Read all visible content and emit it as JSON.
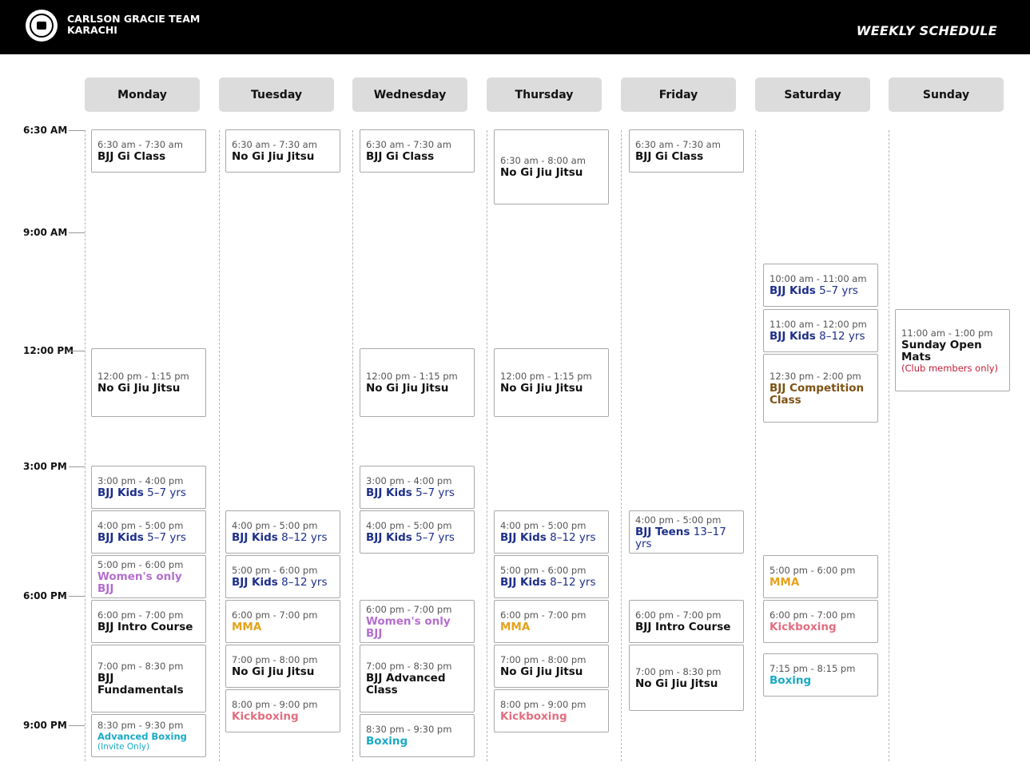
{
  "header": {
    "brand_line1": "CARLSON GRACIE TEAM",
    "brand_line2": "KARACHI",
    "title": "WEEKLY SCHEDULE",
    "logo_icon": "carlson-gracie-logo-icon"
  },
  "colors": {
    "background": "#ffffff",
    "header": "#000000",
    "default": "#111111",
    "kids": "#1d2f8a",
    "womens": "#b46ecf",
    "mma": "#e6a21c",
    "kickboxing": "#e26e80",
    "boxing": "#18aac6",
    "competition": "#7d5214",
    "members": "#c4203a"
  },
  "days": [
    "Monday",
    "Tuesday",
    "Wednesday",
    "Thursday",
    "Friday",
    "Saturday",
    "Sunday"
  ],
  "times": [
    "6:30 AM",
    "9:00 AM",
    "12:00 PM",
    "3:00 PM",
    "6:00 PM",
    "9:00 PM"
  ],
  "classes": [
    {
      "day": 0,
      "time": "6:30 am - 7:30 am",
      "name": "BJJ Gi Class",
      "suffix": "",
      "style": "default",
      "note": ""
    },
    {
      "day": 0,
      "time": "12:00 pm - 1:15 pm",
      "name": "No Gi Jiu Jitsu",
      "suffix": "",
      "style": "default",
      "note": ""
    },
    {
      "day": 0,
      "time": "3:00 pm - 4:00 pm",
      "name": "BJJ Kids",
      "suffix": " 5–7 yrs",
      "style": "kids",
      "note": ""
    },
    {
      "day": 0,
      "time": "4:00 pm - 5:00 pm",
      "name": "BJJ Kids",
      "suffix": " 5–7 yrs",
      "style": "kids",
      "note": ""
    },
    {
      "day": 0,
      "time": "5:00 pm - 6:00 pm",
      "name": "Women's only BJJ",
      "suffix": "",
      "style": "womens",
      "note": ""
    },
    {
      "day": 0,
      "time": "6:00 pm - 7:00 pm",
      "name": "BJJ Intro Course",
      "suffix": "",
      "style": "default",
      "note": ""
    },
    {
      "day": 0,
      "time": "7:00 pm - 8:30 pm",
      "name": "BJJ Fundamentals",
      "suffix": "",
      "style": "default",
      "note": ""
    },
    {
      "day": 0,
      "time": "8:30 pm - 9:30 pm",
      "name": "Advanced Boxing",
      "suffix": "",
      "style": "boxing",
      "note": "(Invite Only)"
    },
    {
      "day": 1,
      "time": "6:30 am - 7:30 am",
      "name": "No Gi Jiu Jitsu",
      "suffix": "",
      "style": "default",
      "note": ""
    },
    {
      "day": 1,
      "time": "4:00 pm - 5:00 pm",
      "name": "BJJ Kids",
      "suffix": " 8–12 yrs",
      "style": "kids",
      "note": ""
    },
    {
      "day": 1,
      "time": "5:00 pm - 6:00 pm",
      "name": "BJJ Kids",
      "suffix": " 8–12 yrs",
      "style": "kids",
      "note": ""
    },
    {
      "day": 1,
      "time": "6:00 pm - 7:00 pm",
      "name": "MMA",
      "suffix": "",
      "style": "mma",
      "note": ""
    },
    {
      "day": 1,
      "time": "7:00 pm - 8:00 pm",
      "name": "No Gi Jiu Jitsu",
      "suffix": "",
      "style": "default",
      "note": ""
    },
    {
      "day": 1,
      "time": "8:00 pm - 9:00 pm",
      "name": "Kickboxing",
      "suffix": "",
      "style": "kickboxing",
      "note": ""
    },
    {
      "day": 2,
      "time": "6:30 am - 7:30 am",
      "name": "BJJ Gi Class",
      "suffix": "",
      "style": "default",
      "note": ""
    },
    {
      "day": 2,
      "time": "12:00 pm - 1:15 pm",
      "name": "No Gi Jiu Jitsu",
      "suffix": "",
      "style": "default",
      "note": ""
    },
    {
      "day": 2,
      "time": "3:00 pm - 4:00 pm",
      "name": "BJJ Kids",
      "suffix": " 5–7 yrs",
      "style": "kids",
      "note": ""
    },
    {
      "day": 2,
      "time": "4:00 pm - 5:00 pm",
      "name": "BJJ Kids",
      "suffix": " 5–7 yrs",
      "style": "kids",
      "note": ""
    },
    {
      "day": 2,
      "time": "6:00 pm - 7:00 pm",
      "name": "Women's only BJJ",
      "suffix": "",
      "style": "womens",
      "note": ""
    },
    {
      "day": 2,
      "time": "7:00 pm - 8:30 pm",
      "name": "BJJ Advanced Class",
      "suffix": "",
      "style": "default",
      "note": ""
    },
    {
      "day": 2,
      "time": "8:30 pm - 9:30 pm",
      "name": "Boxing",
      "suffix": "",
      "style": "boxing",
      "note": ""
    },
    {
      "day": 3,
      "time": "6:30 am - 8:00 am",
      "name": "No Gi Jiu Jitsu",
      "suffix": "",
      "style": "default",
      "note": ""
    },
    {
      "day": 3,
      "time": "12:00 pm - 1:15 pm",
      "name": "No Gi Jiu Jitsu",
      "suffix": "",
      "style": "default",
      "note": ""
    },
    {
      "day": 3,
      "time": "4:00 pm - 5:00 pm",
      "name": "BJJ Kids",
      "suffix": " 8–12 yrs",
      "style": "kids",
      "note": ""
    },
    {
      "day": 3,
      "time": "5:00 pm - 6:00 pm",
      "name": "BJJ Kids",
      "suffix": " 8–12 yrs",
      "style": "kids",
      "note": ""
    },
    {
      "day": 3,
      "time": "6:00 pm - 7:00 pm",
      "name": "MMA",
      "suffix": "",
      "style": "mma",
      "note": ""
    },
    {
      "day": 3,
      "time": "7:00 pm - 8:00 pm",
      "name": "No Gi Jiu Jitsu",
      "suffix": "",
      "style": "default",
      "note": ""
    },
    {
      "day": 3,
      "time": "8:00 pm - 9:00 pm",
      "name": "Kickboxing",
      "suffix": "",
      "style": "kickboxing",
      "note": ""
    },
    {
      "day": 4,
      "time": "6:30 am - 7:30 am",
      "name": "BJJ Gi Class",
      "suffix": "",
      "style": "default",
      "note": ""
    },
    {
      "day": 4,
      "time": "4:00 pm - 5:00 pm",
      "name": "BJJ Teens",
      "suffix": " 13–17 yrs",
      "style": "kids",
      "note": ""
    },
    {
      "day": 4,
      "time": "6:00 pm - 7:00 pm",
      "name": "BJJ Intro Course",
      "suffix": "",
      "style": "default",
      "note": ""
    },
    {
      "day": 4,
      "time": "7:00 pm - 8:30 pm",
      "name": "No Gi Jiu Jitsu",
      "suffix": "",
      "style": "default",
      "note": ""
    },
    {
      "day": 5,
      "time": "10:00 am - 11:00 am",
      "name": "BJJ Kids",
      "suffix": " 5–7 yrs",
      "style": "kids",
      "note": ""
    },
    {
      "day": 5,
      "time": "11:00 am - 12:00 pm",
      "name": "BJJ Kids",
      "suffix": " 8–12 yrs",
      "style": "kids",
      "note": ""
    },
    {
      "day": 5,
      "time": "12:30 pm - 2:00 pm",
      "name": "BJJ  Competition Class",
      "suffix": "",
      "style": "competition",
      "note": ""
    },
    {
      "day": 5,
      "time": "5:00 pm - 6:00 pm",
      "name": "MMA",
      "suffix": "",
      "style": "mma",
      "note": ""
    },
    {
      "day": 5,
      "time": "6:00 pm - 7:00 pm",
      "name": "Kickboxing",
      "suffix": "",
      "style": "kickboxing",
      "note": ""
    },
    {
      "day": 5,
      "time": "7:15 pm - 8:15 pm",
      "name": "Boxing",
      "suffix": "",
      "style": "boxing",
      "note": ""
    },
    {
      "day": 6,
      "time": "11:00 am - 1:00 pm",
      "name": "Sunday Open Mats",
      "suffix": "",
      "style": "default",
      "note": "(Club members only)"
    }
  ]
}
